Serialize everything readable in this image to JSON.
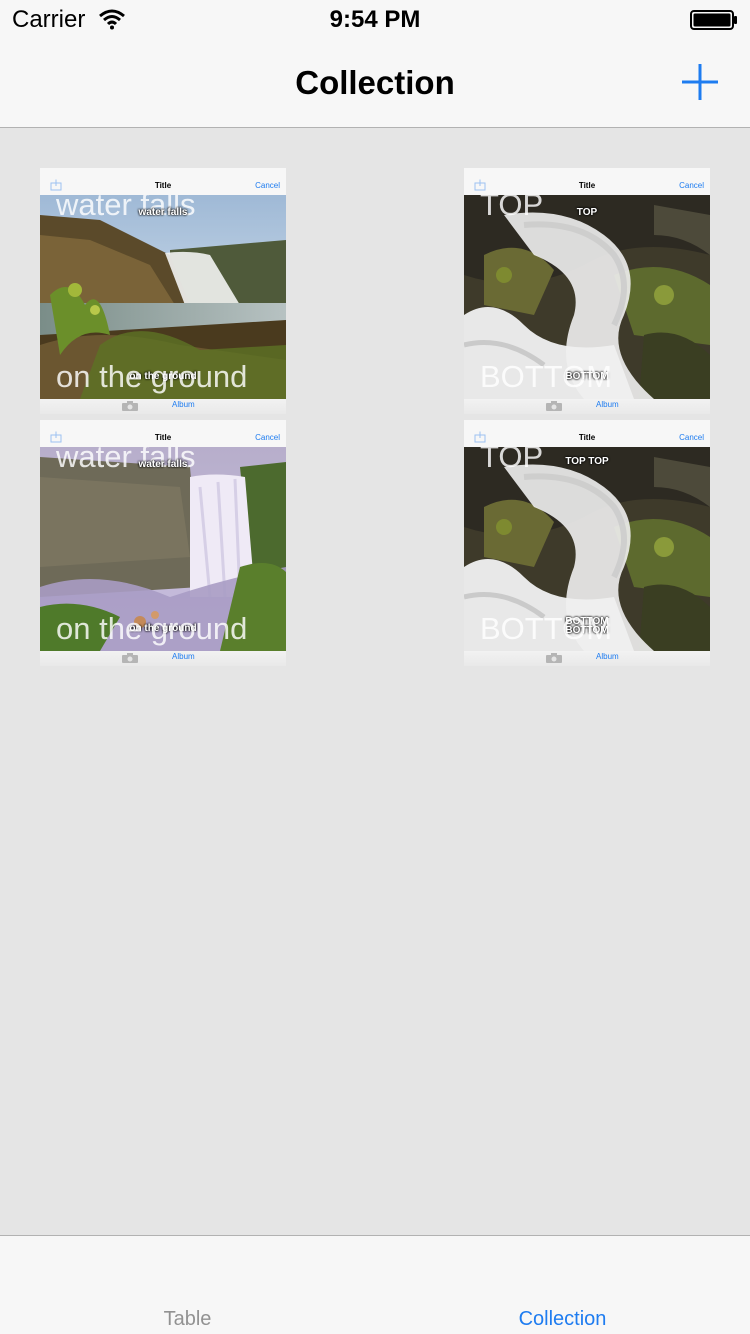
{
  "status_bar": {
    "carrier": "Carrier",
    "time": "9:54 PM",
    "wifi_icon": "wifi-icon",
    "battery_icon": "battery-icon"
  },
  "nav_bar": {
    "title": "Collection",
    "add_icon": "plus-icon"
  },
  "collection": {
    "items": [
      {
        "image": "waterfall-cliff-photo",
        "thumb_title": "Title",
        "thumb_cancel": "Cancel",
        "thumb_album": "Album",
        "top_text": "water falls",
        "bottom_text": "on the ground",
        "small_top_text": "water falls",
        "small_bottom_text": "on the ground"
      },
      {
        "image": "waterfall-rocks-photo",
        "thumb_title": "Title",
        "thumb_cancel": "Cancel",
        "thumb_album": "Album",
        "top_text": "TOP",
        "bottom_text": "BOTTOM",
        "small_top_text": "TOP",
        "small_bottom_text": "BOTTOM"
      },
      {
        "image": "waterfall-mist-photo",
        "thumb_title": "Title",
        "thumb_cancel": "Cancel",
        "thumb_album": "Album",
        "top_text": "water falls",
        "bottom_text": "on the ground",
        "small_top_text": "water falls",
        "small_bottom_text": "on the ground"
      },
      {
        "image": "waterfall-rocks-photo",
        "thumb_title": "Title",
        "thumb_cancel": "Cancel",
        "thumb_album": "Album",
        "top_text": "TOP",
        "bottom_text": "BOTTOM",
        "small_top_text": "TOP TOP",
        "small_bottom_text": "BOTTOM BOTTOM"
      }
    ]
  },
  "tab_bar": {
    "tabs": [
      {
        "label": "Table",
        "selected": false
      },
      {
        "label": "Collection",
        "selected": true
      }
    ]
  },
  "colors": {
    "accent": "#1e7cf0",
    "background": "#e5e5e5",
    "bar": "#f7f7f7",
    "inactive_tab": "#929292"
  }
}
